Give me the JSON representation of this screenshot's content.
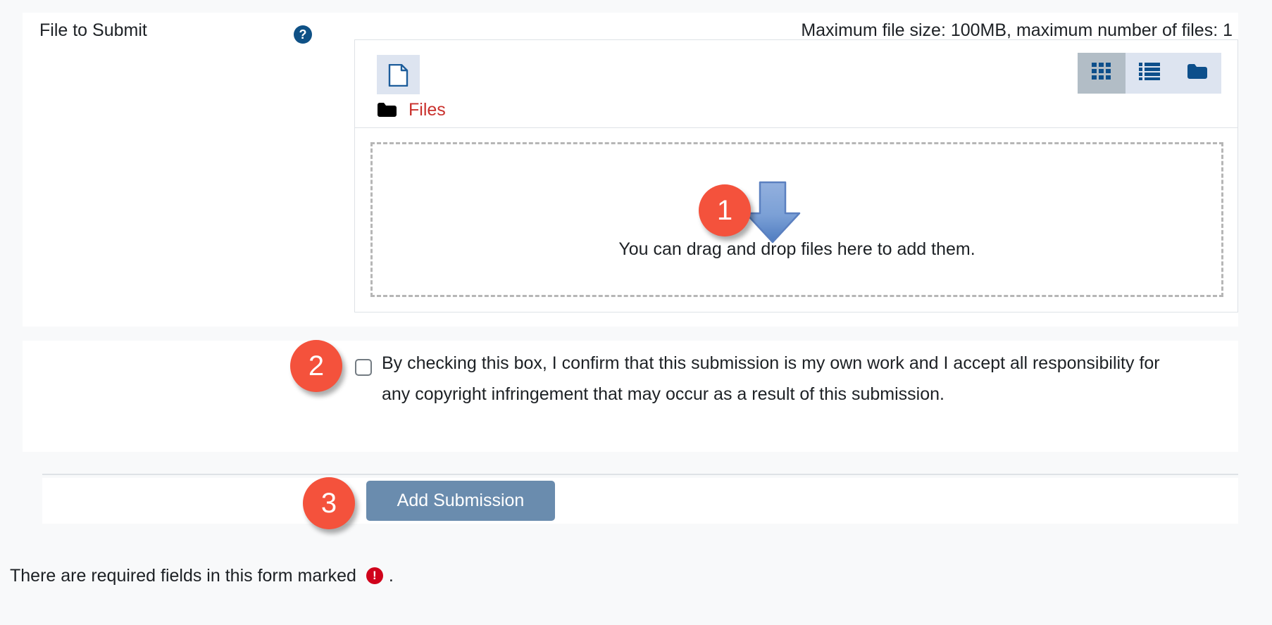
{
  "field": {
    "label": "File to Submit",
    "help_icon": "help-circle-icon",
    "help_glyph": "?",
    "max_info": "Maximum file size: 100MB, maximum number of files: 1"
  },
  "filepicker": {
    "add_file_icon": "document-add-icon",
    "view_toggles": [
      {
        "id": "grid",
        "icon": "grid-view-icon",
        "active": true
      },
      {
        "id": "list",
        "icon": "list-view-icon",
        "active": false
      },
      {
        "id": "tree",
        "icon": "folder-tree-icon",
        "active": false
      }
    ],
    "breadcrumb": {
      "folder_icon": "folder-icon",
      "label": "Files"
    },
    "dropzone_text": "You can drag and drop files here to add them."
  },
  "annotations": {
    "step_1": "1",
    "step_2": "2",
    "step_3": "3",
    "arrow_icon": "down-arrow-icon"
  },
  "confirm": {
    "checked": false,
    "text": "By checking this box, I confirm that this submission is my own work and I accept all responsibility for any copyright infringement that may occur as a result of this submission."
  },
  "actions": {
    "add_submission_label": "Add Submission"
  },
  "footer": {
    "required_prefix": "There are required fields in this form marked",
    "required_icon": "exclamation-circle-icon",
    "required_glyph": "!",
    "required_suffix": "."
  },
  "colors": {
    "page_bg": "#f8f9fa",
    "panel_bg": "#ffffff",
    "badge": "#f4523c",
    "accent_blue": "#0f5186",
    "breadcrumb_red": "#c9302c",
    "button_blue": "#6a8cae",
    "required_red": "#d0021b",
    "border": "#dee2e6"
  }
}
